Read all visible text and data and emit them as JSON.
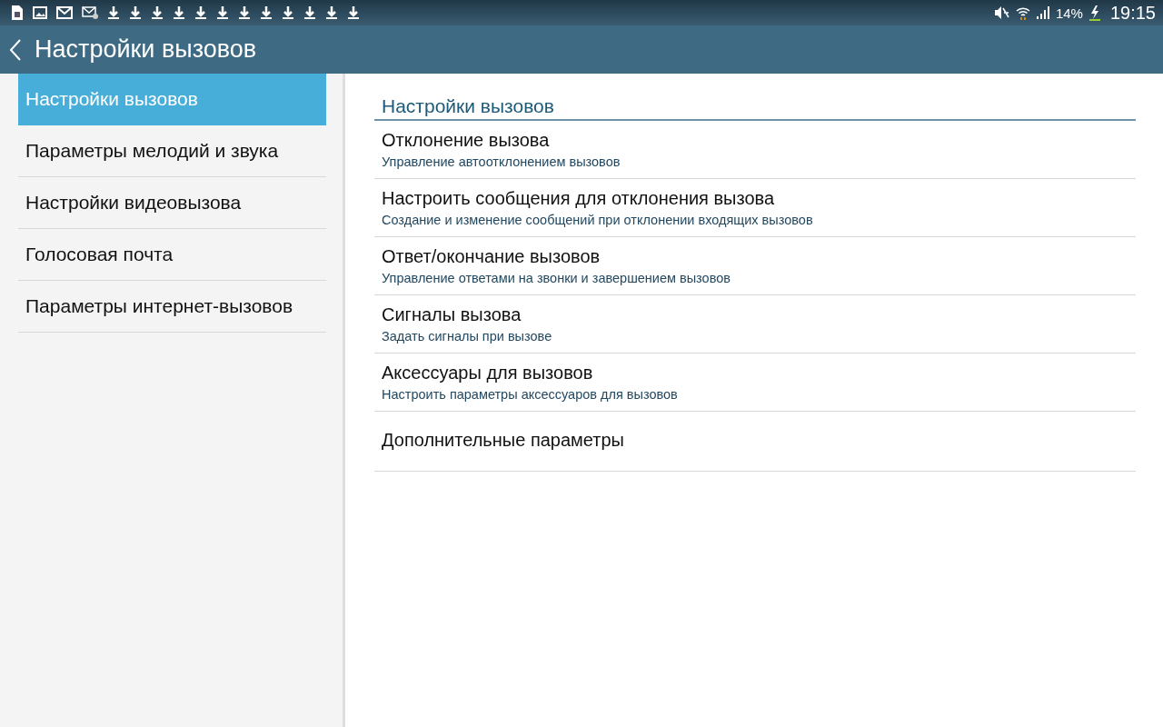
{
  "status_bar": {
    "battery": "14%",
    "time": "19:15"
  },
  "app_bar": {
    "title": "Настройки вызовов"
  },
  "sidebar": {
    "items": [
      {
        "label": "Настройки вызовов",
        "selected": true
      },
      {
        "label": "Параметры мелодий и звука",
        "selected": false
      },
      {
        "label": "Настройки видеовызова",
        "selected": false
      },
      {
        "label": "Голосовая почта",
        "selected": false
      },
      {
        "label": "Параметры интернет-вызовов",
        "selected": false
      }
    ]
  },
  "content": {
    "section_title": "Настройки вызовов",
    "items": [
      {
        "title": "Отклонение вызова",
        "summary": "Управление автоотклонением вызовов"
      },
      {
        "title": "Настроить сообщения для отклонения вызова",
        "summary": "Создание и изменение сообщений при отклонении входящих вызовов"
      },
      {
        "title": "Ответ/окончание вызовов",
        "summary": "Управление ответами на звонки и завершением вызовов"
      },
      {
        "title": "Сигналы вызова",
        "summary": "Задать сигналы при вызове"
      },
      {
        "title": "Аксессуары для вызовов",
        "summary": "Настроить параметры аксессуаров для вызовов"
      },
      {
        "title": "Дополнительные параметры"
      }
    ]
  }
}
